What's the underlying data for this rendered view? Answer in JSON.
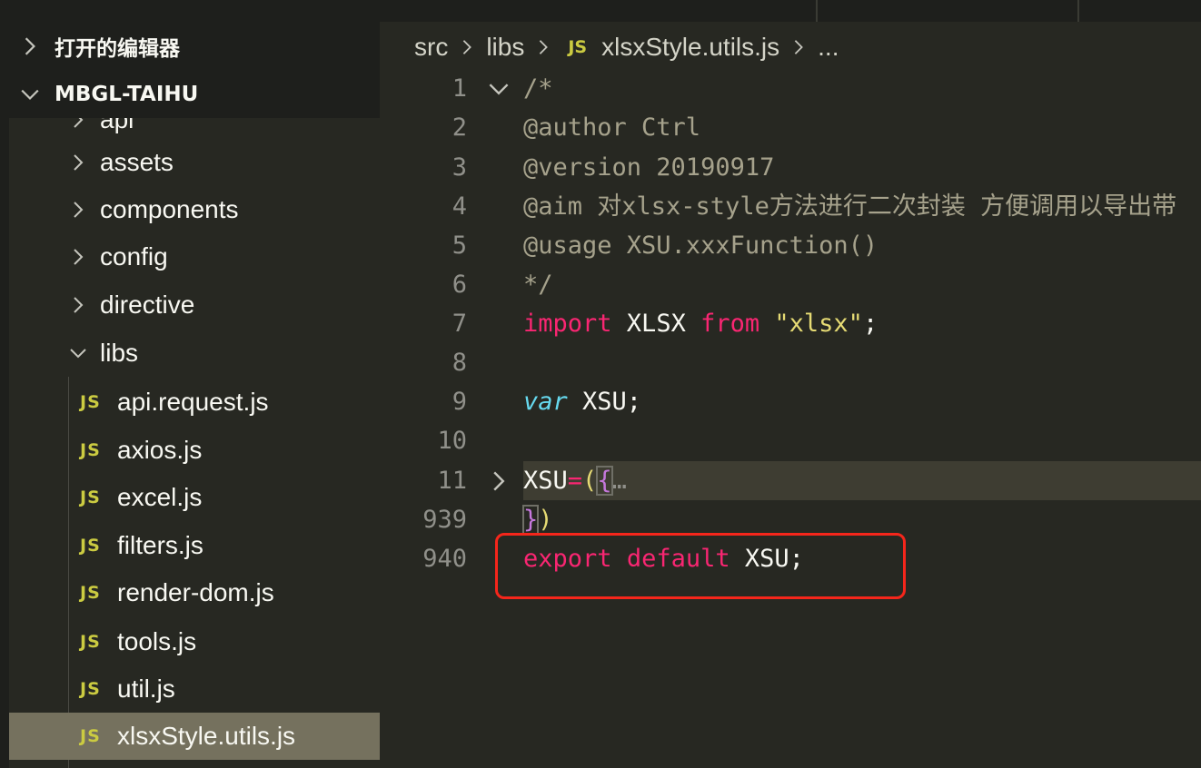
{
  "sidebar": {
    "open_editors_label": "打开的编辑器",
    "project_label": "MBGL-TAIHU",
    "partial_folder": "api",
    "folders": [
      {
        "label": "assets",
        "expanded": false
      },
      {
        "label": "components",
        "expanded": false
      },
      {
        "label": "config",
        "expanded": false
      },
      {
        "label": "directive",
        "expanded": false
      },
      {
        "label": "libs",
        "expanded": true
      }
    ],
    "file_icon_text": "JS",
    "files": [
      {
        "label": "api.request.js"
      },
      {
        "label": "axios.js"
      },
      {
        "label": "excel.js"
      },
      {
        "label": "filters.js"
      },
      {
        "label": "render-dom.js"
      },
      {
        "label": "tools.js"
      },
      {
        "label": "util.js"
      },
      {
        "label": "xlsxStyle.utils.js",
        "selected": true
      }
    ]
  },
  "breadcrumb": {
    "parts": [
      "src",
      "libs"
    ],
    "icon": "JS",
    "file": "xlsxStyle.utils.js",
    "more": "..."
  },
  "editor": {
    "line_numbers": [
      "1",
      "2",
      "3",
      "4",
      "5",
      "6",
      "7",
      "8",
      "9",
      "10",
      "11",
      "939",
      "940"
    ],
    "lines": {
      "l1": "/*",
      "l2": "@author Ctrl",
      "l3": "@version 20190917",
      "l4": "@aim 对xlsx-style方法进行二次封装 方便调用以导出带",
      "l5": "@usage XSU.xxxFunction()",
      "l6": "*/",
      "l7": {
        "kw1": "import",
        "name": " XLSX ",
        "kw2": "from",
        "sp": " ",
        "str": "\"xlsx\"",
        "end": ";"
      },
      "l9": {
        "kw": "var",
        "rest": " XSU;"
      },
      "l11": {
        "name": "XSU",
        "op": "=",
        "paren": "(",
        "brace": "{",
        "ellipsis": "…"
      },
      "l939": {
        "brace": "}",
        "paren": ")"
      },
      "l940": {
        "kw1": "export",
        "sp1": " ",
        "kw2": "default",
        "rest": " XSU;"
      }
    }
  },
  "colors": {
    "annotation_box": "#f5261b",
    "keyword": "#f92672",
    "string": "#e6db74",
    "comment": "#a6a28c"
  }
}
